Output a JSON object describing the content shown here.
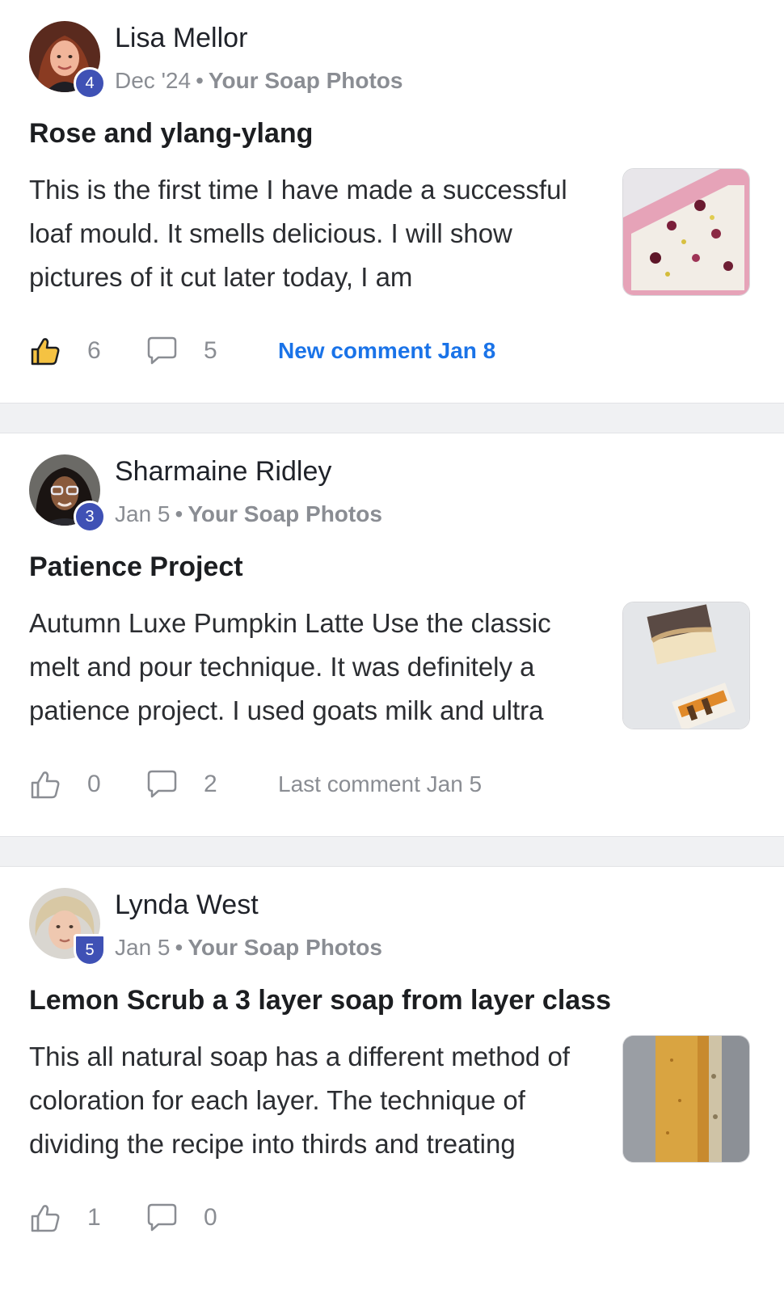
{
  "posts": [
    {
      "author": "Lisa Mellor",
      "badge": "4",
      "date": "Dec '24",
      "separator": "•",
      "category": "Your Soap Photos",
      "title": "Rose and ylang-ylang",
      "excerpt": "This is the first time I have made a successful loaf mould. It smells delicious. I will show pictures of it cut later today, I am",
      "likes": "6",
      "comments": "5",
      "activity": "New comment Jan 8",
      "activity_is_new": true,
      "liked": true
    },
    {
      "author": "Sharmaine Ridley",
      "badge": "3",
      "date": "Jan 5",
      "separator": "•",
      "category": "Your Soap Photos",
      "title": "Patience Project",
      "excerpt": "Autumn Luxe Pumpkin Latte Use the classic melt and pour technique. It was definitely a patience project. I used goats milk and ultra",
      "likes": "0",
      "comments": "2",
      "activity": "Last comment Jan 5",
      "activity_is_new": false,
      "liked": false
    },
    {
      "author": "Lynda West",
      "badge": "5",
      "date": "Jan 5",
      "separator": "•",
      "category": "Your Soap Photos",
      "title": "Lemon Scrub a 3 layer soap from layer class",
      "excerpt": "This all natural soap has a different method of coloration for each layer. The technique of dividing the recipe into thirds and treating",
      "likes": "1",
      "comments": "0",
      "activity": "",
      "activity_is_new": false,
      "liked": false
    }
  ],
  "colors": {
    "link_blue": "#1a73e8",
    "badge_indigo": "#3f51b5",
    "like_active": "#f5c242",
    "muted_text": "#8a8d93"
  },
  "icons": {
    "like": "thumbs-up-icon",
    "comment": "speech-bubble-icon"
  }
}
